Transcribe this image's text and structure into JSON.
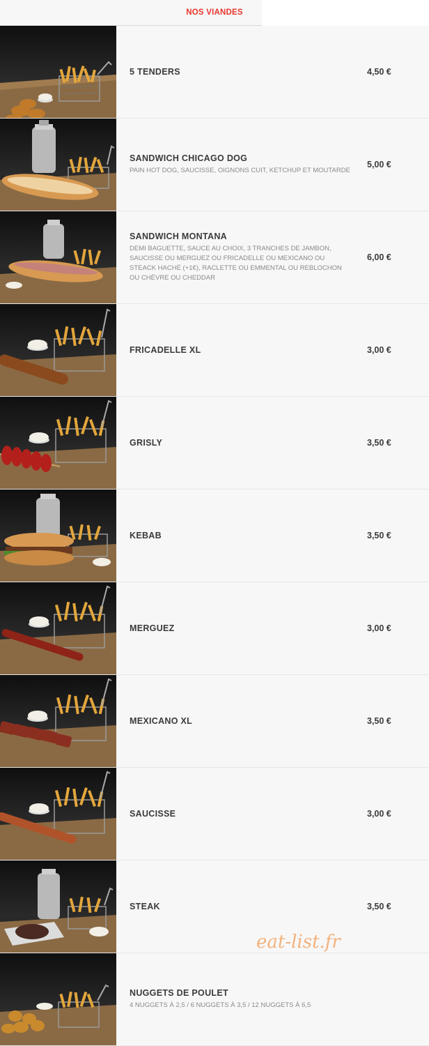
{
  "header": {
    "tab_label": "NOS VIANDES"
  },
  "items": [
    {
      "name": "5 TENDERS",
      "description": "",
      "price": "4,50 €"
    },
    {
      "name": "SANDWICH CHICAGO DOG",
      "description": "PAIN HOT DOG, SAUCISSE, OIGNONS CUIT, KETCHUP ET MOUTARDE",
      "price": "5,00 €"
    },
    {
      "name": "SANDWICH MONTANA",
      "description": "DEMI BAGUETTE, SAUCE AU CHOIX, 3 TRANCHES DE JAMBON, SAUCISSE OU MERGUEZ OU FRICADELLE OU MEXICANO OU STEACK HACHÉ (+1€), RACLETTE OU EMMENTAL OU REBLOCHON OU CHÈVRE OU CHEDDAR",
      "price": "6,00 €"
    },
    {
      "name": "FRICADELLE XL",
      "description": "",
      "price": "3,00 €"
    },
    {
      "name": "GRISLY",
      "description": "",
      "price": "3,50 €"
    },
    {
      "name": "KEBAB",
      "description": "",
      "price": "3,50 €"
    },
    {
      "name": "MERGUEZ",
      "description": "",
      "price": "3,00 €"
    },
    {
      "name": "MEXICANO XL",
      "description": "",
      "price": "3,50 €"
    },
    {
      "name": "SAUCISSE",
      "description": "",
      "price": "3,00 €"
    },
    {
      "name": "STEAK",
      "description": "",
      "price": "3,50 €"
    },
    {
      "name": "NUGGETS DE POULET",
      "description": "4 NUGGETS À 2,5 / 6 NUGGETS À 3,5 / 12 NUGGETS À 6,5",
      "price": ""
    }
  ],
  "watermark": "eat-list.fr",
  "colors": {
    "accent": "#e8362d",
    "watermark": "#f3b27d"
  }
}
